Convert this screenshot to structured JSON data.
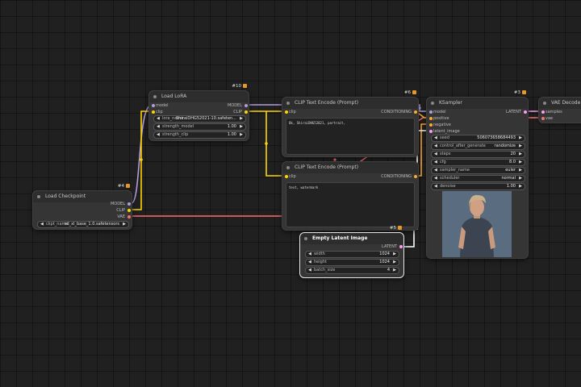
{
  "colors": {
    "model": "#b39ddb",
    "clip": "#ffd500",
    "vae": "#ff6e6e",
    "conditioning": "#ffa931",
    "latent": "#ff9cf9"
  },
  "nodes": {
    "load_checkpoint": {
      "title": "Load Checkpoint",
      "id": "#4",
      "outputs": [
        "MODEL",
        "CLIP",
        "VAE"
      ],
      "widget": {
        "label": "ckpt_name",
        "value": "sd_xl_base_1.0.safetensors"
      }
    },
    "load_lora": {
      "title": "Load LoRA",
      "id": "#10",
      "inputs": [
        "model",
        "clip"
      ],
      "outputs": [
        "MODEL",
        "CLIP"
      ],
      "widgets": [
        {
          "label": "lora_name",
          "value": "ShiraiDHG52021-10.safeten..."
        },
        {
          "label": "strength_model",
          "value": "1.00"
        },
        {
          "label": "strength_clip",
          "value": "1.00"
        }
      ]
    },
    "clip_pos": {
      "title": "CLIP Text Encode (Prompt)",
      "id": "#6",
      "input": "clip",
      "output": "CONDITIONING",
      "text": "8k, ShiraiDHG52021, portrait,"
    },
    "clip_neg": {
      "title": "CLIP Text Encode (Prompt)",
      "input": "clip",
      "output": "CONDITIONING",
      "text": "text, watermark"
    },
    "empty_latent": {
      "title": "Empty Latent Image",
      "id": "#5",
      "output": "LATENT",
      "widgets": [
        {
          "label": "width",
          "value": "1024"
        },
        {
          "label": "height",
          "value": "1024"
        },
        {
          "label": "batch_size",
          "value": "4"
        }
      ]
    },
    "ksampler": {
      "title": "KSampler",
      "id": "#3",
      "inputs": [
        "model",
        "positive",
        "negative",
        "latent_image"
      ],
      "output": "LATENT",
      "widgets": [
        {
          "label": "seed",
          "value": "506073658684493"
        },
        {
          "label": "control_after_generate",
          "value": "randomize"
        },
        {
          "label": "steps",
          "value": "20"
        },
        {
          "label": "cfg",
          "value": "8.0"
        },
        {
          "label": "sampler_name",
          "value": "euler"
        },
        {
          "label": "scheduler",
          "value": "normal"
        },
        {
          "label": "denoise",
          "value": "1.00"
        }
      ]
    },
    "vae_decode": {
      "title": "VAE Decode",
      "inputs": [
        "samples",
        "vae"
      ]
    }
  }
}
